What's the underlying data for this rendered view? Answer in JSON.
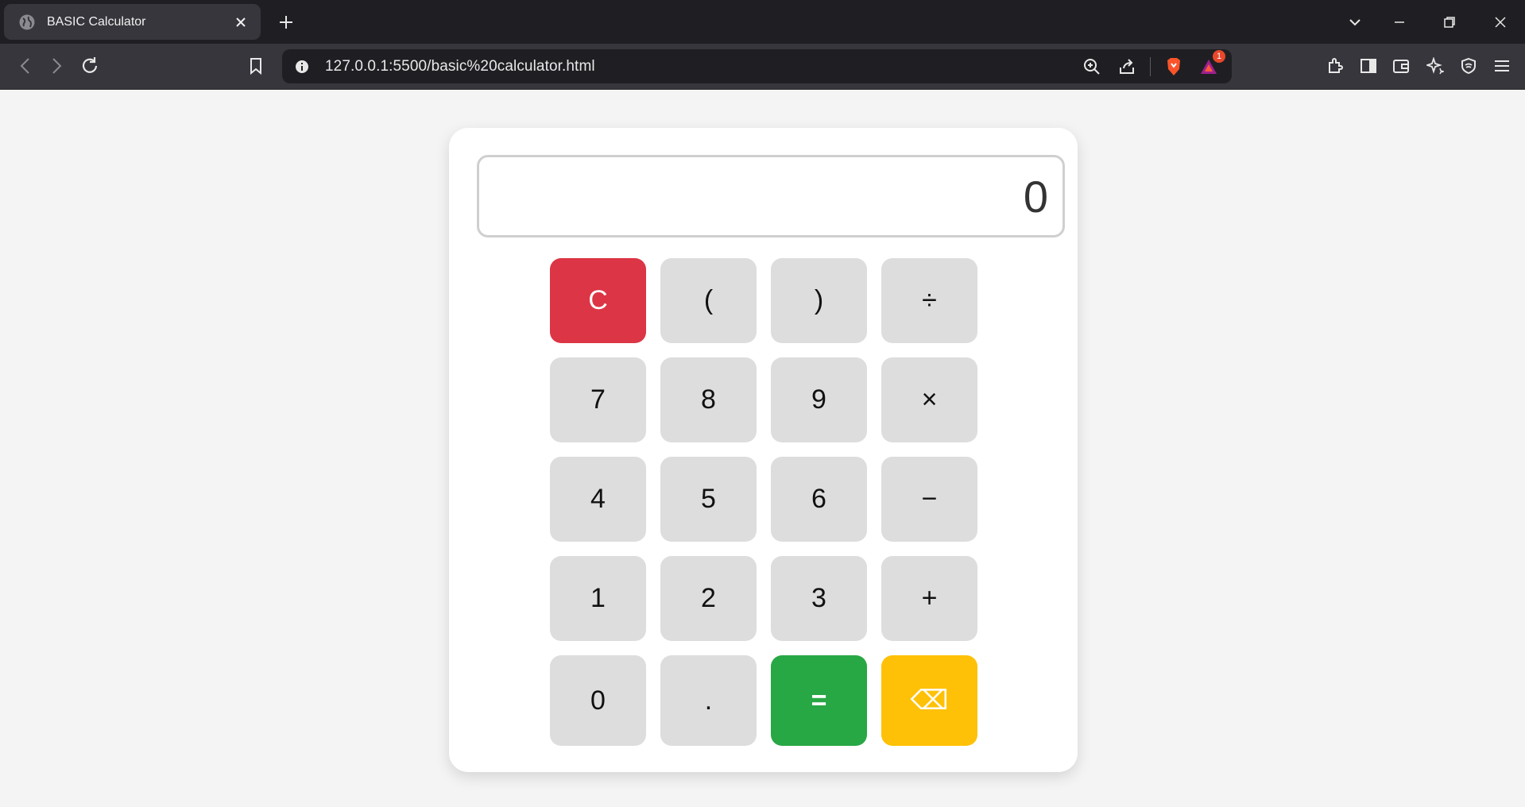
{
  "browser": {
    "tab_title": "BASIC Calculator",
    "url": "127.0.0.1:5500/basic%20calculator.html",
    "notification_count": "1"
  },
  "calculator": {
    "display_value": "0",
    "keys": [
      {
        "label": "C",
        "name": "clear-button",
        "type": "clear"
      },
      {
        "label": "(",
        "name": "open-paren-button",
        "type": "normal"
      },
      {
        "label": ")",
        "name": "close-paren-button",
        "type": "normal"
      },
      {
        "label": "÷",
        "name": "divide-button",
        "type": "normal"
      },
      {
        "label": "7",
        "name": "digit-7-button",
        "type": "normal"
      },
      {
        "label": "8",
        "name": "digit-8-button",
        "type": "normal"
      },
      {
        "label": "9",
        "name": "digit-9-button",
        "type": "normal"
      },
      {
        "label": "×",
        "name": "multiply-button",
        "type": "normal"
      },
      {
        "label": "4",
        "name": "digit-4-button",
        "type": "normal"
      },
      {
        "label": "5",
        "name": "digit-5-button",
        "type": "normal"
      },
      {
        "label": "6",
        "name": "digit-6-button",
        "type": "normal"
      },
      {
        "label": "−",
        "name": "subtract-button",
        "type": "normal"
      },
      {
        "label": "1",
        "name": "digit-1-button",
        "type": "normal"
      },
      {
        "label": "2",
        "name": "digit-2-button",
        "type": "normal"
      },
      {
        "label": "3",
        "name": "digit-3-button",
        "type": "normal"
      },
      {
        "label": "+",
        "name": "add-button",
        "type": "normal"
      },
      {
        "label": "0",
        "name": "digit-0-button",
        "type": "normal"
      },
      {
        "label": ".",
        "name": "decimal-button",
        "type": "normal"
      },
      {
        "label": "=",
        "name": "equals-button",
        "type": "equals"
      },
      {
        "label": "⌫",
        "name": "backspace-button",
        "type": "back"
      }
    ]
  },
  "colors": {
    "clear": "#dc3545",
    "equals": "#28a745",
    "back": "#ffc107",
    "key": "#dddddd"
  }
}
